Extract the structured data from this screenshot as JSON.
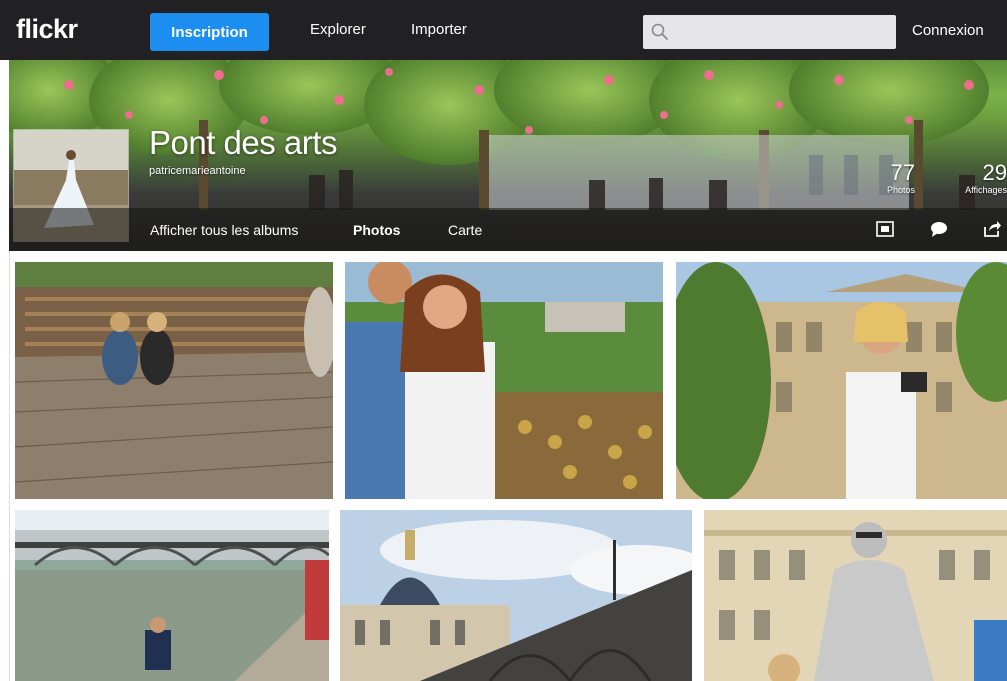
{
  "nav": {
    "logo": "flickr",
    "signup_label": "Inscription",
    "explore_label": "Explorer",
    "upload_label": "Importer",
    "search_placeholder": "",
    "login_label": "Connexion"
  },
  "album": {
    "title": "Pont des arts",
    "owner": "patricemarieantoine",
    "photos_count": "77",
    "photos_label": "Photos",
    "views_count": "29",
    "views_label": "Affichages",
    "tabs": {
      "all_albums": "Afficher tous les albums",
      "photos": "Photos",
      "map": "Carte"
    }
  },
  "icons": {
    "search": "search-icon",
    "slideshow": "slideshow-icon",
    "comment": "comment-icon",
    "share": "share-icon"
  },
  "colors": {
    "topbar": "#212124",
    "accent": "#1c8ef0"
  },
  "photos": [
    {
      "id": "bridge-locks-sitting-women"
    },
    {
      "id": "couple-hugging-locks"
    },
    {
      "id": "woman-camera-louvre"
    },
    {
      "id": "pont-des-arts-seine"
    },
    {
      "id": "institut-de-france-dome"
    },
    {
      "id": "silver-statue-performer"
    }
  ]
}
